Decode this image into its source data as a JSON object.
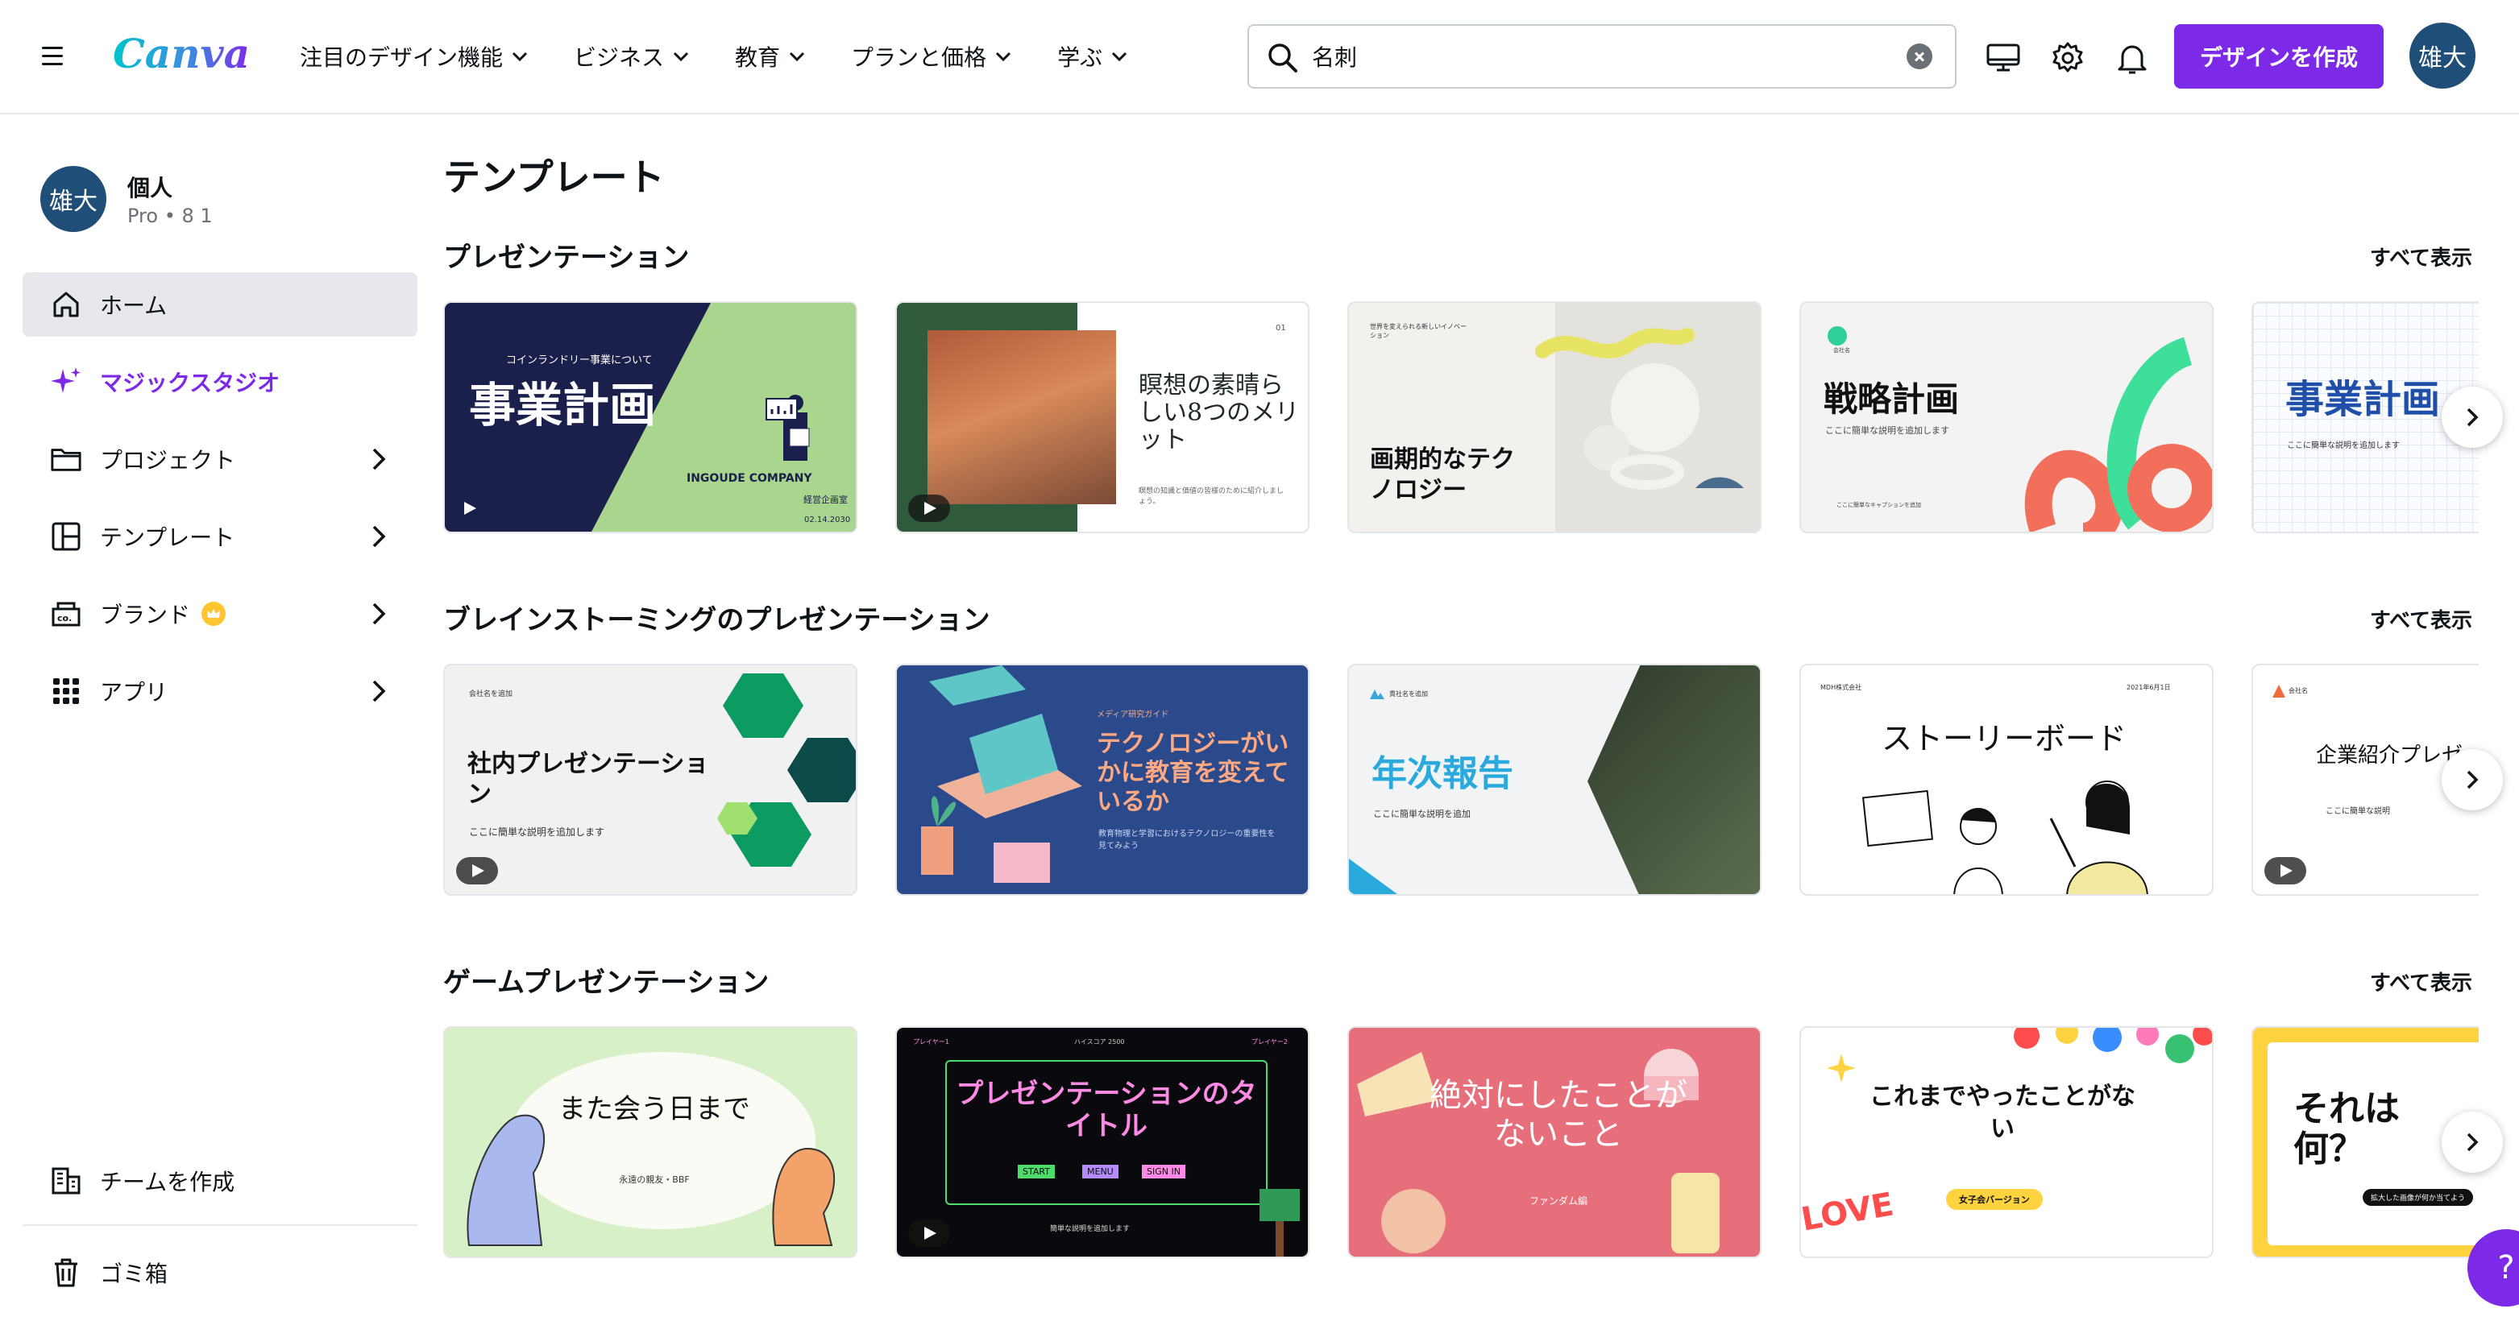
{
  "app": {
    "name": "Canva"
  },
  "header": {
    "logo_text": "Canva",
    "nav": [
      {
        "label": "注目のデザイン機能"
      },
      {
        "label": "ビジネス"
      },
      {
        "label": "教育"
      },
      {
        "label": "プランと価格"
      },
      {
        "label": "学ぶ"
      }
    ],
    "search": {
      "value": "名刺"
    },
    "create_button": "デザインを作成",
    "avatar_initials": "雄大"
  },
  "sidebar": {
    "account": {
      "avatar_initials": "雄大",
      "name": "個人",
      "plan": "Pro • 8 1"
    },
    "items": [
      {
        "label": "ホーム",
        "icon": "home-icon",
        "active": true
      },
      {
        "label": "マジックスタジオ",
        "icon": "sparkle-icon"
      },
      {
        "label": "プロジェクト",
        "icon": "folder-icon"
      },
      {
        "label": "テンプレート",
        "icon": "template-icon"
      },
      {
        "label": "ブランド",
        "icon": "brand-icon"
      },
      {
        "label": "アプリ",
        "icon": "apps-icon"
      }
    ],
    "bottom": [
      {
        "label": "チームを作成",
        "icon": "team-icon"
      },
      {
        "label": "ゴミ箱",
        "icon": "trash-icon"
      }
    ]
  },
  "main": {
    "title": "テンプレート",
    "see_all": "すべて表示",
    "sections": [
      {
        "title": "プレゼンテーション",
        "cards": [
          {
            "subtitle": "コインランドリー事業について",
            "title": "事業計画",
            "company": "INGOUDE COMPANY",
            "label1": "経営企画室",
            "date": "02.14.2030"
          },
          {
            "title": "瞑想の素晴らしい8つのメリット",
            "page": "01",
            "desc": "瞑想の知識と価値の皆様のために紹介しましょう。"
          },
          {
            "tag": "世界を変えられる新しいイノベーション",
            "title": "画期的なテクノロジー"
          },
          {
            "company": "会社名",
            "title": "戦略計画",
            "desc": "ここに簡単な説明を追加します",
            "note": "ここに簡単なキャプションを追加"
          },
          {
            "title": "事業計画",
            "desc": "ここに簡単な説明を追加します"
          }
        ]
      },
      {
        "title": "ブレインストーミングのプレゼンテーション",
        "cards": [
          {
            "company": "会社名を追加",
            "title": "社内プレゼンテーション",
            "desc": "ここに簡単な説明を追加します"
          },
          {
            "tag": "メディア研究ガイド",
            "title": "テクノロジーがいかに教育を変えているか",
            "desc": "教育物理と学習におけるテクノロジーの重要性を見てみよう"
          },
          {
            "company": "貴社名を追加",
            "title": "年次報告",
            "desc": "ここに簡単な説明を追加"
          },
          {
            "company": "MDH株式会社",
            "date": "2021年6月1日",
            "title": "ストーリーボード"
          },
          {
            "company": "会社名",
            "title": "企業紹介プレゼン",
            "desc": "ここに簡単な説明"
          }
        ]
      },
      {
        "title": "ゲームプレゼンテーション",
        "cards": [
          {
            "title": "また会う日まで",
            "desc": "永遠の親友・BBF"
          },
          {
            "hud_left": "プレイヤー1",
            "hud_mid": "ハイスコア 2500",
            "hud_right": "プレイヤー2",
            "title": "プレゼンテーションのタイトル",
            "buttons": [
              "START",
              "MENU",
              "SIGN IN"
            ],
            "desc": "簡単な説明を追加します"
          },
          {
            "title": "絶対にしたことがないこと",
            "desc": "ファンダム編"
          },
          {
            "title": "これまでやったことがない",
            "badge": "女子会バージョン",
            "love": "LOVE"
          },
          {
            "title": "それは何？",
            "desc": "拡大した画像が何か当てよう"
          }
        ]
      }
    ]
  },
  "help_button": "?"
}
